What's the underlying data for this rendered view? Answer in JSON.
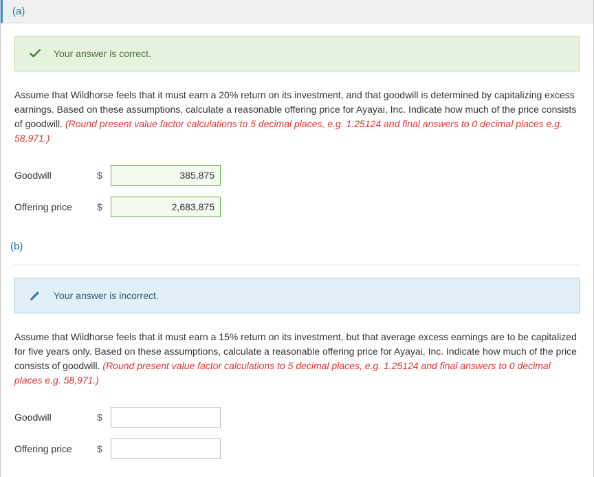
{
  "partA": {
    "label": "(a)",
    "feedback": {
      "status": "correct",
      "message": "Your answer is correct."
    },
    "question_plain": "Assume that Wildhorse feels that it must earn a 20% return on its investment, and that goodwill is determined by capitalizing excess earnings. Based on these assumptions, calculate a reasonable offering price for Ayayai, Inc. Indicate how much of the price consists of goodwill. ",
    "round_note": "(Round present value factor calculations to 5 decimal places, e.g. 1.25124 and final answers to 0 decimal places e.g. 58,971.)",
    "rows": {
      "goodwill": {
        "label": "Goodwill",
        "currency": "$",
        "value": "385,875"
      },
      "offering": {
        "label": "Offering price",
        "currency": "$",
        "value": "2,683,875"
      }
    }
  },
  "partB": {
    "label": "(b)",
    "feedback": {
      "status": "incorrect",
      "message": "Your answer is incorrect."
    },
    "question_plain": "Assume that Wildhorse feels that it must earn a 15% return on its investment, but that average excess earnings are to be capitalized for five years only. Based on these assumptions, calculate a reasonable offering price for Ayayai, Inc. Indicate how much of the price consists of goodwill. ",
    "round_note": "(Round present value factor calculations to 5 decimal places, e.g. 1.25124 and final answers to 0 decimal places e.g. 58,971.)",
    "rows": {
      "goodwill": {
        "label": "Goodwill",
        "currency": "$",
        "value": ""
      },
      "offering": {
        "label": "Offering price",
        "currency": "$",
        "value": ""
      }
    }
  }
}
